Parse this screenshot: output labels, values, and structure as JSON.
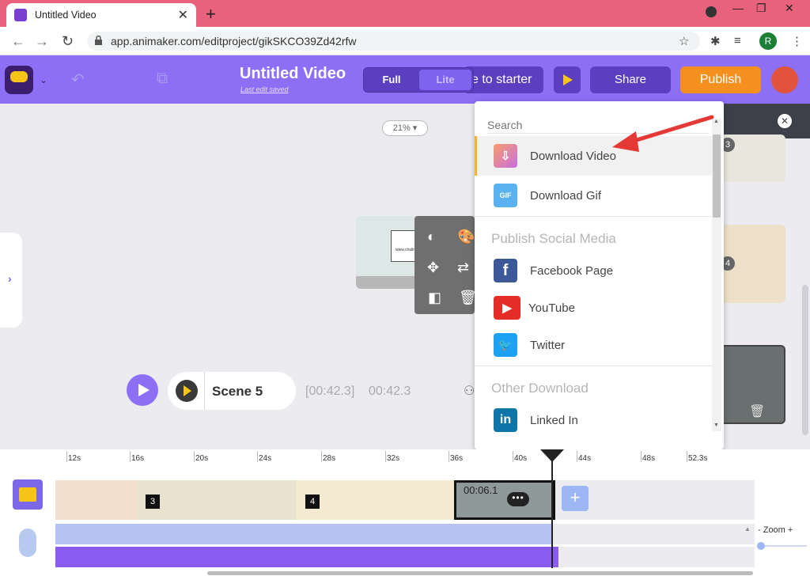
{
  "browser": {
    "tab_title": "Untitled Video",
    "tab_close": "✕",
    "new_tab": "+",
    "url": "app.animaker.com/editproject/gikSKCO39Zd42rfw",
    "profile_initial": "R",
    "win_min": "—",
    "win_max": "❐",
    "win_close": "✕"
  },
  "header": {
    "project_title": "Untitled Video",
    "last_saved": "Last edit saved",
    "mode_full": "Full",
    "mode_lite": "Lite",
    "starter_label": "e to starter",
    "share_label": "Share",
    "publish_label": "Publish"
  },
  "canvas": {
    "zoom_label": "21% ▾",
    "watermark": "www.chalinacademy.ir"
  },
  "scene": {
    "name": "Scene 5",
    "time_range": "[00:42.3]",
    "time_total": "00:42.3"
  },
  "right_panel": {
    "thumbs": [
      {
        "num": "3"
      },
      {
        "num": "4"
      }
    ]
  },
  "dropdown": {
    "search_placeholder": "Search",
    "items_top": [
      {
        "label": "Download Video",
        "icon": "download-video-icon",
        "color": "#e77bc3"
      },
      {
        "label": "Download Gif",
        "icon": "gif-icon",
        "color": "#5ab3f0"
      }
    ],
    "section_social": "Publish Social Media",
    "items_social": [
      {
        "label": "Facebook Page",
        "icon": "facebook-icon",
        "color": "#3b5998"
      },
      {
        "label": "YouTube",
        "icon": "youtube-icon",
        "color": "#e52d27"
      },
      {
        "label": "Twitter",
        "icon": "twitter-icon",
        "color": "#1da1f2"
      }
    ],
    "section_other": "Other Download",
    "items_other": [
      {
        "label": "Linked In",
        "icon": "linkedin-icon",
        "color": "#0e76a8"
      }
    ]
  },
  "timeline": {
    "ruler": [
      "12s",
      "16s",
      "20s",
      "24s",
      "28s",
      "32s",
      "36s",
      "40s",
      "44s",
      "48s",
      "52.3s"
    ],
    "clip_badges": [
      "3",
      "4"
    ],
    "clip_time": "00:06.1",
    "clip_menu": "•••",
    "add_label": "+",
    "zoom_label": "-  Zoom  +"
  },
  "colors": {
    "brand": "#8c6ff5",
    "publish": "#f5901e",
    "accent_yellow": "#f5c518"
  }
}
